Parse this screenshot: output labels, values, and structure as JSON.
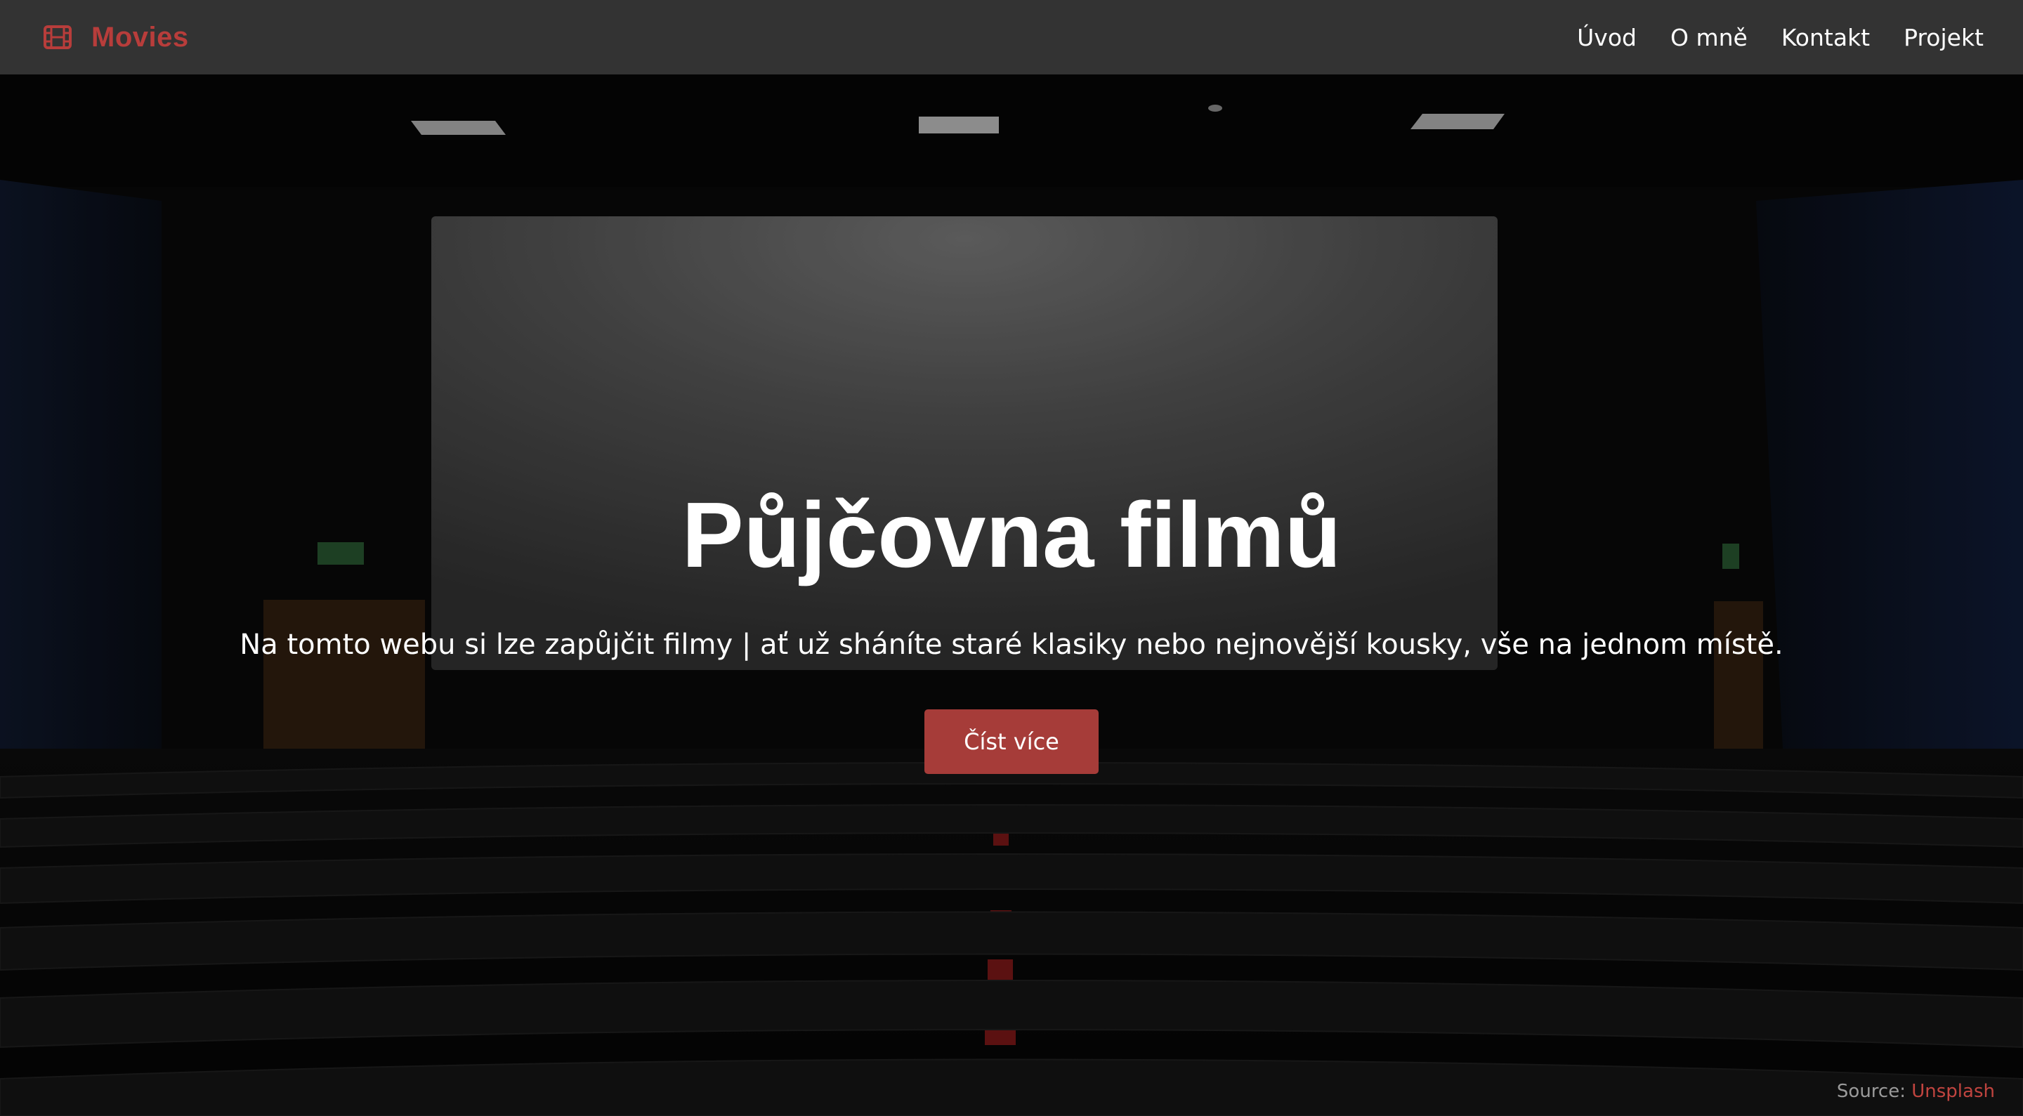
{
  "navbar": {
    "brand": {
      "icon": "film-icon",
      "label": "Movies",
      "color": "#b83d3b"
    },
    "links": [
      {
        "label": "Úvod"
      },
      {
        "label": "O mně"
      },
      {
        "label": "Kontakt"
      },
      {
        "label": "Projekt"
      }
    ],
    "background": "#333333"
  },
  "hero": {
    "background": "cinema-auditorium-photo",
    "title": "Půjčovna filmů",
    "subtitle": "Na tomto webu si lze zapůjčit filmy | ať už sháníte staré klasiky nebo nejnovější kousky, vše na jednom místě.",
    "button": {
      "label": "Číst více",
      "color": "#a63c39"
    }
  },
  "source": {
    "prefix": "Source:",
    "link": "Unsplash",
    "link_color": "#c0443f"
  }
}
